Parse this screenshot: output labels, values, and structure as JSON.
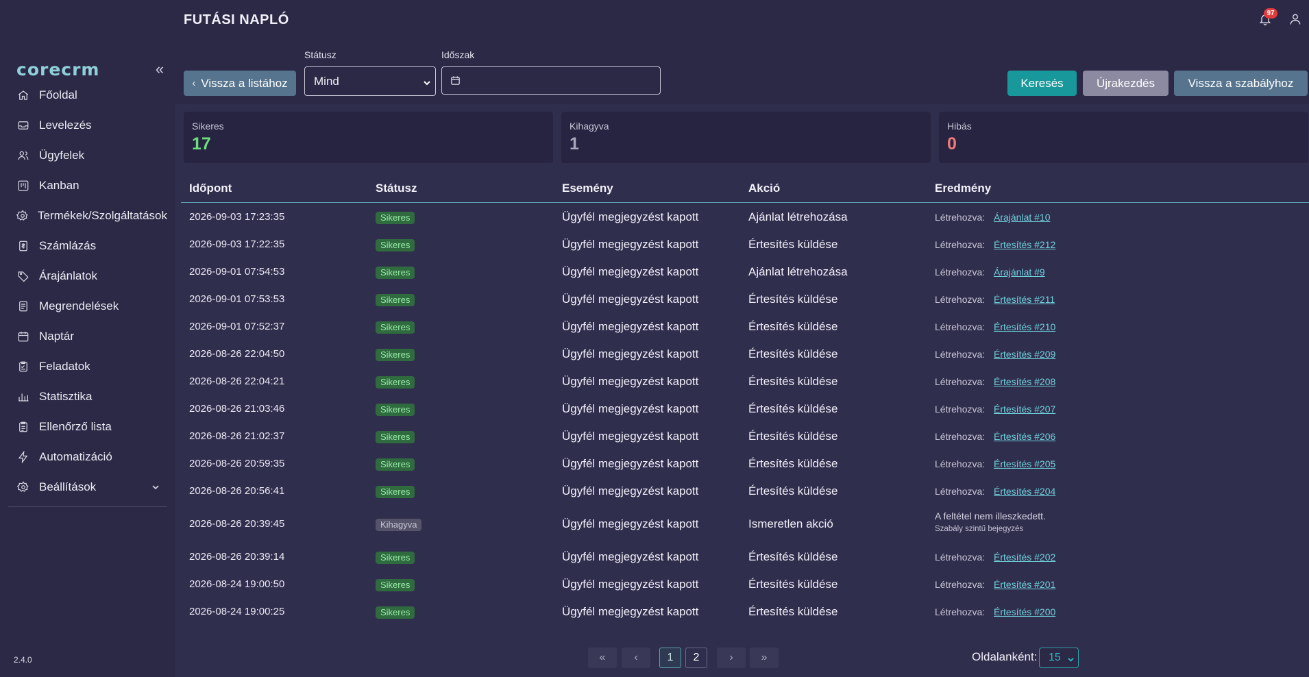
{
  "app": {
    "logo": "corecrm",
    "version": "2.4.0"
  },
  "header": {
    "title": "FUTÁSI NAPLÓ",
    "notification_count": "97"
  },
  "sidebar": {
    "items": [
      {
        "label": "Főoldal",
        "icon": "home-icon"
      },
      {
        "label": "Levelezés",
        "icon": "inbox-icon"
      },
      {
        "label": "Ügyfelek",
        "icon": "users-icon"
      },
      {
        "label": "Kanban",
        "icon": "kanban-icon"
      },
      {
        "label": "Termékek/Szolgáltatások",
        "icon": "gear-icon"
      },
      {
        "label": "Számlázás",
        "icon": "invoice-icon"
      },
      {
        "label": "Árajánlatok",
        "icon": "tag-icon"
      },
      {
        "label": "Megrendelések",
        "icon": "document-icon"
      },
      {
        "label": "Naptár",
        "icon": "calendar-icon"
      },
      {
        "label": "Feladatok",
        "icon": "tasks-icon"
      },
      {
        "label": "Statisztika",
        "icon": "chart-icon"
      },
      {
        "label": "Ellenőrző lista",
        "icon": "checklist-icon"
      },
      {
        "label": "Automatizáció",
        "icon": "bolt-icon"
      },
      {
        "label": "Beállítások",
        "icon": "settings-icon"
      }
    ]
  },
  "filters": {
    "back_to_list": "Vissza a listához",
    "status_label": "Státusz",
    "status_value": "Mind",
    "period_label": "Időszak",
    "period_value": "",
    "search": "Keresés",
    "reset": "Újrakezdés",
    "back_to_rules": "Vissza a szabályhoz"
  },
  "summary": {
    "success": {
      "label": "Sikeres",
      "value": "17",
      "color": "#6fdf7e"
    },
    "skipped": {
      "label": "Kihagyva",
      "value": "1",
      "color": "#a8a7ba"
    },
    "errors": {
      "label": "Hibás",
      "value": "0",
      "color": "#f07a78"
    }
  },
  "table": {
    "headers": [
      "Időpont",
      "Státusz",
      "Esemény",
      "Akció",
      "Eredmény"
    ],
    "rows": [
      {
        "time": "2026-09-03 17:23:35",
        "status": "Sikeres",
        "event": "Ügyfél megjegyzést kapott",
        "action": "Ajánlat létrehozása",
        "result_label": "Létrehozva:",
        "result_link": "Árajánlat #10"
      },
      {
        "time": "2026-09-03 17:22:35",
        "status": "Sikeres",
        "event": "Ügyfél megjegyzést kapott",
        "action": "Értesítés küldése",
        "result_label": "Létrehozva:",
        "result_link": "Értesítés #212"
      },
      {
        "time": "2026-09-01 07:54:53",
        "status": "Sikeres",
        "event": "Ügyfél megjegyzést kapott",
        "action": "Ajánlat létrehozása",
        "result_label": "Létrehozva:",
        "result_link": "Árajánlat #9"
      },
      {
        "time": "2026-09-01 07:53:53",
        "status": "Sikeres",
        "event": "Ügyfél megjegyzést kapott",
        "action": "Értesítés küldése",
        "result_label": "Létrehozva:",
        "result_link": "Értesítés #211"
      },
      {
        "time": "2026-09-01 07:52:37",
        "status": "Sikeres",
        "event": "Ügyfél megjegyzést kapott",
        "action": "Értesítés küldése",
        "result_label": "Létrehozva:",
        "result_link": "Értesítés #210"
      },
      {
        "time": "2026-08-26 22:04:50",
        "status": "Sikeres",
        "event": "Ügyfél megjegyzést kapott",
        "action": "Értesítés küldése",
        "result_label": "Létrehozva:",
        "result_link": "Értesítés #209"
      },
      {
        "time": "2026-08-26 22:04:21",
        "status": "Sikeres",
        "event": "Ügyfél megjegyzést kapott",
        "action": "Értesítés küldése",
        "result_label": "Létrehozva:",
        "result_link": "Értesítés #208"
      },
      {
        "time": "2026-08-26 21:03:46",
        "status": "Sikeres",
        "event": "Ügyfél megjegyzést kapott",
        "action": "Értesítés küldése",
        "result_label": "Létrehozva:",
        "result_link": "Értesítés #207"
      },
      {
        "time": "2026-08-26 21:02:37",
        "status": "Sikeres",
        "event": "Ügyfél megjegyzést kapott",
        "action": "Értesítés küldése",
        "result_label": "Létrehozva:",
        "result_link": "Értesítés #206"
      },
      {
        "time": "2026-08-26 20:59:35",
        "status": "Sikeres",
        "event": "Ügyfél megjegyzést kapott",
        "action": "Értesítés küldése",
        "result_label": "Létrehozva:",
        "result_link": "Értesítés #205"
      },
      {
        "time": "2026-08-26 20:56:41",
        "status": "Sikeres",
        "event": "Ügyfél megjegyzést kapott",
        "action": "Értesítés küldése",
        "result_label": "Létrehozva:",
        "result_link": "Értesítés #204"
      },
      {
        "time": "2026-08-26 20:39:45",
        "status": "Kihagyva",
        "event": "Ügyfél megjegyzést kapott",
        "action": "Ismeretlen akció",
        "result_note": "A feltétel nem illeszkedett.",
        "result_subnote": "Szabály szintű bejegyzés"
      },
      {
        "time": "2026-08-26 20:39:14",
        "status": "Sikeres",
        "event": "Ügyfél megjegyzést kapott",
        "action": "Értesítés küldése",
        "result_label": "Létrehozva:",
        "result_link": "Értesítés #202"
      },
      {
        "time": "2026-08-24 19:00:50",
        "status": "Sikeres",
        "event": "Ügyfél megjegyzést kapott",
        "action": "Értesítés küldése",
        "result_label": "Létrehozva:",
        "result_link": "Értesítés #201"
      },
      {
        "time": "2026-08-24 19:00:25",
        "status": "Sikeres",
        "event": "Ügyfél megjegyzést kapott",
        "action": "Értesítés küldése",
        "result_label": "Létrehozva:",
        "result_link": "Értesítés #200"
      }
    ]
  },
  "pagination": {
    "first_icon": "double-chevron-left-icon",
    "prev_icon": "chevron-left-icon",
    "next_icon": "chevron-right-icon",
    "last_icon": "double-chevron-right-icon",
    "pages": [
      "1",
      "2"
    ],
    "current_page": "1",
    "per_page_label": "Oldalanként:",
    "per_page_value": "15"
  }
}
